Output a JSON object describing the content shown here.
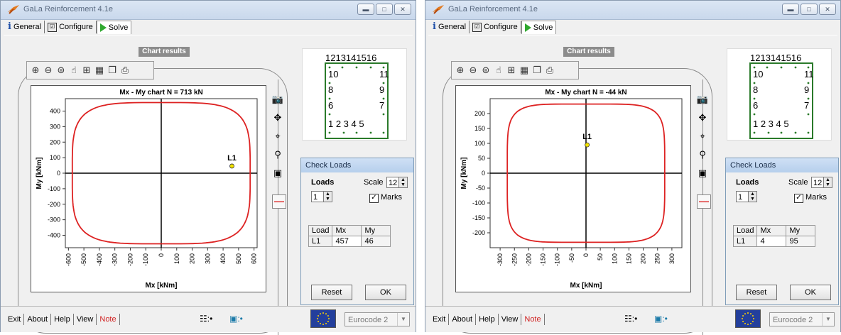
{
  "windows": [
    {
      "title": "GaLa Reinforcement  4.1e",
      "tabs": [
        "General",
        "Configure",
        "Solve"
      ],
      "chart_results_label": "Chart results",
      "chart_data": {
        "type": "line",
        "title": "Mx - My  chart     N = 713 kN",
        "xlabel": "Mx  [kNm]",
        "ylabel": "My  [kNm]",
        "xlim": [
          -620,
          620
        ],
        "ylim": [
          -480,
          480
        ],
        "xticks": [
          -600,
          -500,
          -400,
          -300,
          -200,
          -100,
          0,
          100,
          200,
          300,
          400,
          500,
          600
        ],
        "yticks": [
          400,
          300,
          200,
          100,
          0,
          -100,
          -200,
          -300,
          -400
        ],
        "curve": {
          "ax": 575,
          "ay": 455,
          "p": 4.2,
          "color": "#dd2222"
        },
        "points": [
          {
            "label": "L1",
            "x": 457,
            "y": 46
          }
        ]
      },
      "section_labels": {
        "top": "1213141516",
        "left1": "10",
        "right1": "11",
        "left2": "8",
        "right2": "9",
        "left3": "6",
        "right3": "7",
        "bottom": "1  2  3  4  5"
      },
      "check": {
        "title": "Check Loads",
        "loads_label": "Loads",
        "scale_label": "Scale",
        "scale_value": "12",
        "loads_value": "1",
        "marks_label": "Marks",
        "headers": [
          "Load",
          "Mx",
          "My"
        ],
        "rows": [
          [
            "L1",
            "457",
            "46"
          ]
        ],
        "reset": "Reset",
        "ok": "OK"
      },
      "status": [
        "Exit",
        "About",
        "Help",
        "View",
        "Note"
      ],
      "code": "Eurocode 2"
    },
    {
      "title": "GaLa Reinforcement  4.1e",
      "tabs": [
        "General",
        "Configure",
        "Solve"
      ],
      "chart_results_label": "Chart results",
      "chart_data": {
        "type": "line",
        "title": "Mx - My  chart     N = -44 kN",
        "xlabel": "Mx  [kNm]",
        "ylabel": "My  [kNm]",
        "xlim": [
          -335,
          335
        ],
        "ylim": [
          -250,
          250
        ],
        "xticks": [
          -300,
          -250,
          -200,
          -150,
          -100,
          -50,
          0,
          50,
          100,
          150,
          200,
          250,
          300
        ],
        "yticks": [
          200,
          150,
          100,
          50,
          0,
          -50,
          -100,
          -150,
          -200
        ],
        "curve": {
          "ax": 275,
          "ay": 232,
          "p": 5.5,
          "color": "#dd2222"
        },
        "points": [
          {
            "label": "L1",
            "x": 4,
            "y": 95
          }
        ]
      },
      "section_labels": {
        "top": "1213141516",
        "left1": "10",
        "right1": "11",
        "left2": "8",
        "right2": "9",
        "left3": "6",
        "right3": "7",
        "bottom": "1  2  3  4  5"
      },
      "check": {
        "title": "Check Loads",
        "loads_label": "Loads",
        "scale_label": "Scale",
        "scale_value": "12",
        "loads_value": "1",
        "marks_label": "Marks",
        "headers": [
          "Load",
          "Mx",
          "My"
        ],
        "rows": [
          [
            "L1",
            "4",
            "95"
          ]
        ],
        "reset": "Reset",
        "ok": "OK"
      },
      "status": [
        "Exit",
        "About",
        "Help",
        "View",
        "Note"
      ],
      "code": "Eurocode 2"
    }
  ]
}
